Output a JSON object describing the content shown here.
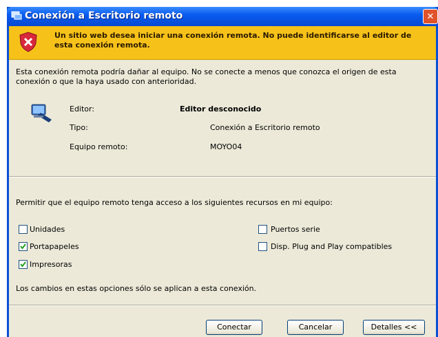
{
  "window": {
    "title": "Conexión a Escritorio remoto",
    "close_glyph": "✕"
  },
  "warning": {
    "text": "Un sitio web desea iniciar una conexión remota. No puede identificarse al editor de esta conexión remota.",
    "icon": "shield-error-icon"
  },
  "description": "Esta conexión remota podría dañar al equipo. No se conecte a menos que conozca el origen de esta conexión o que la haya usado con anterioridad.",
  "details": {
    "publisher_label": "Editor:",
    "publisher_value": "Editor desconocido",
    "type_label": "Tipo:",
    "type_value": "Conexión a Escritorio remoto",
    "remote_label": "Equipo remoto:",
    "remote_value": "MOYO04"
  },
  "permissions": {
    "heading": "Permitir que el equipo remoto tenga acceso a los siguientes recursos en mi equipo:",
    "items": [
      {
        "label": "Unidades",
        "checked": false
      },
      {
        "label": "Portapapeles",
        "checked": true
      },
      {
        "label": "Impresoras",
        "checked": true
      },
      {
        "label": "Puertos serie",
        "checked": false
      },
      {
        "label": "Disp. Plug and Play compatibles",
        "checked": false
      }
    ],
    "note": "Los cambios en estas opciones sólo se aplican a esta conexión."
  },
  "buttons": {
    "connect": "Conectar",
    "cancel": "Cancelar",
    "details": "Detalles <<"
  },
  "colors": {
    "title_bar": "#0a5cf0",
    "warning_bar": "#f6c21a",
    "dialog_bg": "#ece9d8",
    "close": "#e0532b"
  }
}
